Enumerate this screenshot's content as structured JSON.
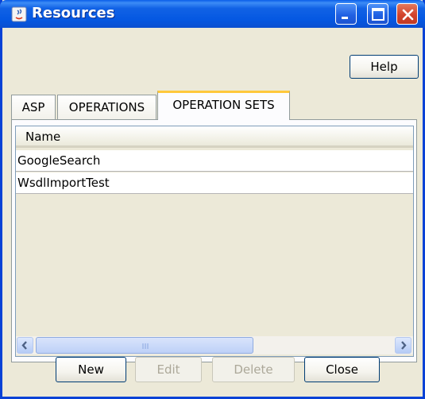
{
  "window": {
    "title": "Resources"
  },
  "toolbar": {
    "help_label": "Help"
  },
  "tabs": [
    {
      "label": "ASP",
      "active": false
    },
    {
      "label": "OPERATIONS",
      "active": false
    },
    {
      "label": "OPERATION SETS",
      "active": true
    }
  ],
  "table": {
    "columns": [
      "Name"
    ],
    "rows": [
      [
        "GoogleSearch"
      ],
      [
        "WsdlImportTest"
      ]
    ]
  },
  "buttons": {
    "new_label": "New",
    "edit_label": "Edit",
    "delete_label": "Delete",
    "close_label": "Close"
  },
  "colors": {
    "titlebar": "#0558e2",
    "close_button": "#d2432c",
    "active_tab_accent": "#ffc83c"
  }
}
